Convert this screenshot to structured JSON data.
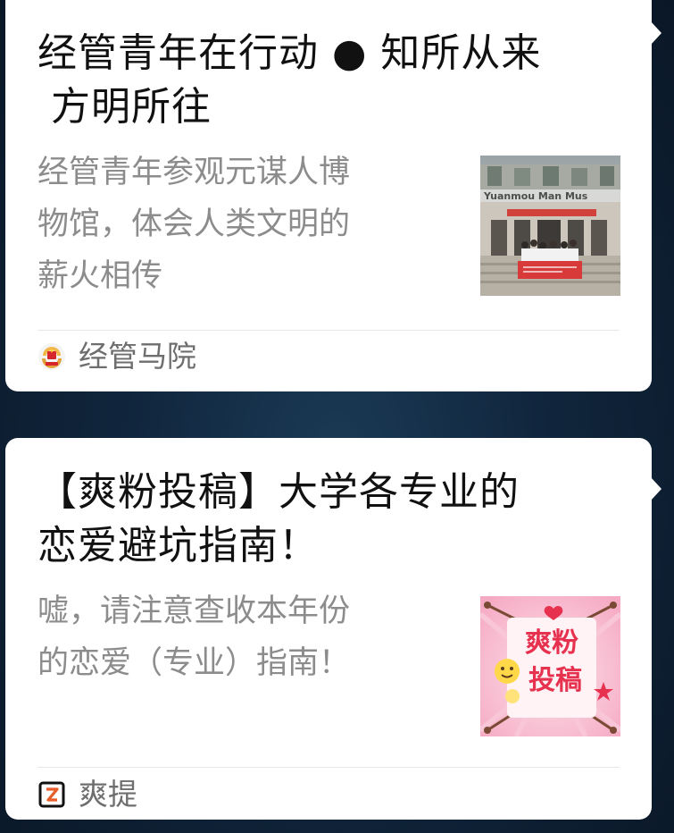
{
  "feed": {
    "articles": [
      {
        "title_line1": "经管青年在行动 ● 知所从来",
        "title_line2": " 方明所往",
        "summary_line1": "经管青年参观元谋人博",
        "summary_line2": "物馆，体会人类文明的",
        "summary_line3": "薪火相传",
        "thumbnail_icon": "museum-group-photo",
        "thumbnail_sign": "Yuanmou Man Mus",
        "source": "经管马院",
        "source_icon": "party-emblem-icon"
      },
      {
        "title_line1": "【爽粉投稿】大学各专业的",
        "title_line2": "恋爱避坑指南！",
        "summary_line1": "嘘，请注意查收本年份",
        "summary_line2": "的恋爱（专业）指南！",
        "thumbnail_icon": "submission-poster",
        "thumbnail_text_line1": "爽粉",
        "thumbnail_text_line2": "投稿",
        "source": "爽提",
        "source_icon": "shuangti-logo-icon"
      }
    ]
  },
  "colors": {
    "background": "#10253c",
    "card": "#ffffff",
    "title": "#111111",
    "summary": "#8c8c8c",
    "source": "#6e6e6e",
    "poster_pink": "#f7b9cf",
    "poster_red": "#e7324f"
  }
}
